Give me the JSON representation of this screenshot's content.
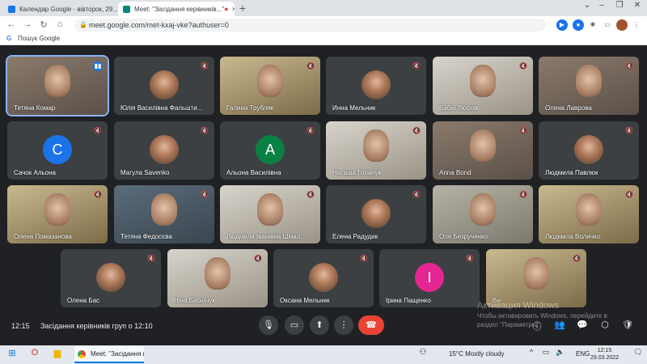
{
  "browser": {
    "tabs": [
      {
        "title": "Календар Google - вівторок, 29...",
        "favicon_color": "#1a73e8"
      },
      {
        "title": "Meet: \"Засідання керівників...\"",
        "favicon_color": "#00897b"
      }
    ],
    "url": "meet.google.com/met-kxaj-vke?authuser=0",
    "bookmark": "Пошук Google"
  },
  "tiles": [
    {
      "name": "Тетяна Комар",
      "type": "video",
      "speaking": true
    },
    {
      "name": "Юлія Василівна Фальшти...",
      "type": "photo"
    },
    {
      "name": "Галина Трубляк",
      "type": "video"
    },
    {
      "name": "Инна Мельник",
      "type": "photo"
    },
    {
      "name": "Бабій Любов",
      "type": "video"
    },
    {
      "name": "Олена Лаврова",
      "type": "video"
    },
    {
      "name": "Сачок Альона",
      "type": "letter",
      "letter": "C",
      "color": "#1a73e8"
    },
    {
      "name": "Магула Savenko",
      "type": "photo"
    },
    {
      "name": "Альона Василівна",
      "type": "letter",
      "letter": "A",
      "color": "#0b8043"
    },
    {
      "name": "Наташа Голачук",
      "type": "video"
    },
    {
      "name": "Anna Bond",
      "type": "video"
    },
    {
      "name": "Людмила Павлюк",
      "type": "photo"
    },
    {
      "name": "Олена Помазанова",
      "type": "video"
    },
    {
      "name": "Тетяна Федосєва",
      "type": "video"
    },
    {
      "name": "Людмила Іванівна Шмал...",
      "type": "video"
    },
    {
      "name": "Елена Радудик",
      "type": "photo"
    },
    {
      "name": "Оля Безрученко",
      "type": "video"
    },
    {
      "name": "Людмила Воличко",
      "type": "video"
    },
    {
      "name": "Олена Бас",
      "type": "photo"
    },
    {
      "name": "Ніна Бабійчук",
      "type": "video"
    },
    {
      "name": "Оксана Мельник",
      "type": "photo"
    },
    {
      "name": "Ірина Пащенко",
      "type": "letter",
      "letter": "І",
      "color": "#e52592"
    },
    {
      "name": "Ви",
      "type": "video"
    }
  ],
  "meeting": {
    "time": "12:15",
    "title": "Засідання керівників груп о 12:10"
  },
  "watermark": {
    "title": "Активация Windows",
    "text": "Чтобы активировать Windows, перейдите в раздел \"Параметры\"."
  },
  "taskbar": {
    "app": "Meet: \"Засідання к...",
    "weather": "15°C  Mostly cloudy",
    "lang": "ENG",
    "time": "12:15",
    "date": "29.03.2022"
  }
}
